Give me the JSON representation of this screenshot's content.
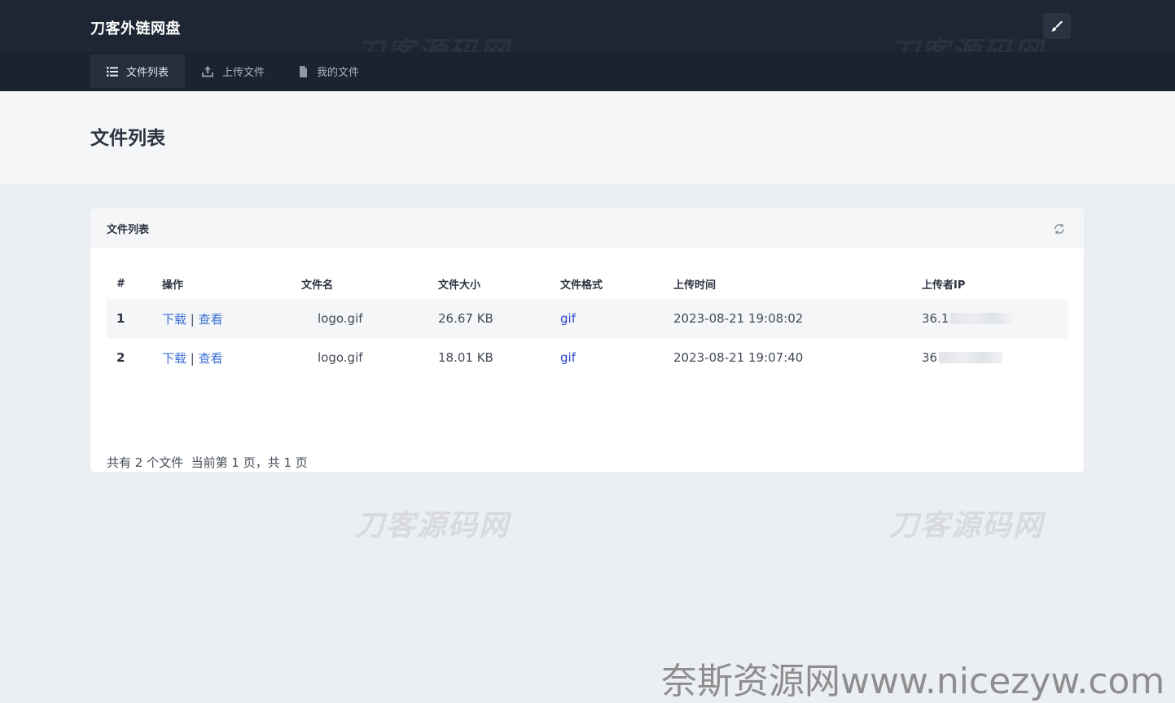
{
  "app": {
    "brand": "刀客外链网盘"
  },
  "nav": {
    "items": [
      {
        "label": "文件列表",
        "icon": "list-icon",
        "active": true
      },
      {
        "label": "上传文件",
        "icon": "upload-icon",
        "active": false
      },
      {
        "label": "我的文件",
        "icon": "file-icon",
        "active": false
      }
    ]
  },
  "page": {
    "title": "文件列表"
  },
  "card": {
    "title": "文件列表",
    "refresh_icon": "refresh-icon"
  },
  "table": {
    "headers": [
      "#",
      "操作",
      "文件名",
      "文件大小",
      "文件格式",
      "上传时间",
      "上传者IP"
    ],
    "rows": [
      {
        "num": "1",
        "download": "下载",
        "sep": "|",
        "view": "查看",
        "name": "logo.gif",
        "size": "26.67 KB",
        "format": "gif",
        "time": "2023-08-21 19:08:02",
        "ip": "36.1"
      },
      {
        "num": "2",
        "download": "下载",
        "sep": "|",
        "view": "查看",
        "name": "logo.gif",
        "size": "18.01 KB",
        "format": "gif",
        "time": "2023-08-21 19:07:40",
        "ip": "36"
      }
    ]
  },
  "summary": "共有 2 个文件  当前第 1 页，共 1 页",
  "pagination": {
    "first": "«",
    "prev": "‹",
    "current": "1",
    "next": "›",
    "last": "»"
  },
  "watermarks": {
    "site": "刀客源码网",
    "footer": "奈斯资源网www.nicezyw.com"
  },
  "colors": {
    "header_bg": "#1e2633",
    "navbar_bg": "#1b2230",
    "link": "#3b6fd4",
    "format": "#2b47c4",
    "page_bg": "#ebeef2"
  }
}
